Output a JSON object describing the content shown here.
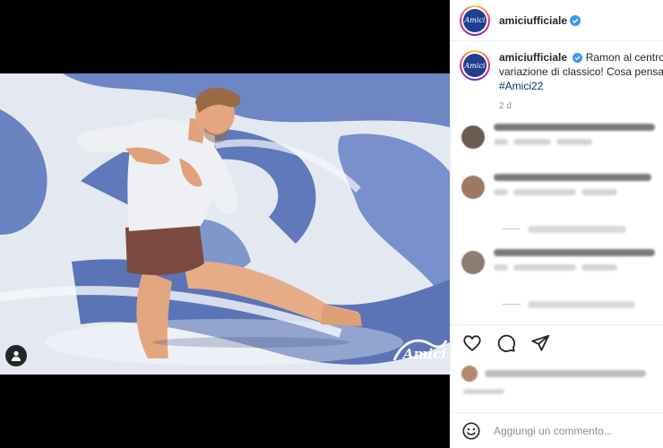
{
  "post": {
    "username": "amiciufficiale",
    "logo_text": "Amici",
    "caption_line1": "Ramon al centro d",
    "caption_line2": "variazione di classico! Cosa pensate",
    "hashtag": "#Amici22",
    "time": "2 d",
    "watermark": "Amici"
  },
  "comment_input": {
    "placeholder": "Aggiungi un commento..."
  },
  "icons": {
    "like": "heart-icon",
    "comment": "speech-bubble-icon",
    "share": "paper-plane-icon",
    "emoji": "smiley-icon",
    "tag": "user-tag-icon",
    "verified": "verified-badge-icon"
  },
  "colors": {
    "verified": "#3897f0",
    "link": "#00376b",
    "logo_bg": "#1f3f8f"
  }
}
